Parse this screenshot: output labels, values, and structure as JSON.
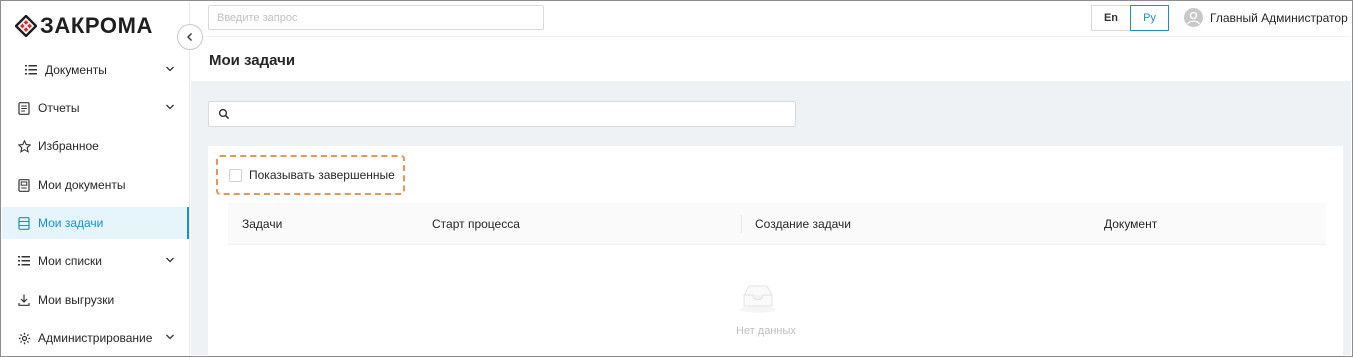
{
  "app": {
    "logo_text": "ЗАКРОМА",
    "accent_color": "#1890d2",
    "logo_color": "#e0302b"
  },
  "sidebar": {
    "items": [
      {
        "label": "Документы",
        "icon": "list-icon",
        "has_chevron": true
      },
      {
        "label": "Отчеты",
        "icon": "report-icon",
        "has_chevron": true
      },
      {
        "label": "Избранное",
        "icon": "star-icon",
        "has_chevron": false
      },
      {
        "label": "Мои документы",
        "icon": "document-icon",
        "has_chevron": false
      },
      {
        "label": "Мои задачи",
        "icon": "tasks-icon",
        "has_chevron": false,
        "active": true
      },
      {
        "label": "Мои списки",
        "icon": "list-icon",
        "has_chevron": true
      },
      {
        "label": "Мои выгрузки",
        "icon": "download-icon",
        "has_chevron": false
      },
      {
        "label": "Администрирование",
        "icon": "gear-icon",
        "has_chevron": true
      }
    ]
  },
  "topbar": {
    "search_placeholder": "Введите запрос",
    "lang_en": "En",
    "lang_ru": "Ру",
    "active_lang": "Ру",
    "user_name": "Главный Администратор"
  },
  "page": {
    "title": "Мои задачи",
    "show_completed_label": "Показывать завершенные",
    "show_completed_checked": false
  },
  "table": {
    "columns": [
      "Задачи",
      "Старт процесса",
      "Создание задачи",
      "Документ"
    ],
    "rows": [],
    "empty_text": "Нет данных"
  }
}
